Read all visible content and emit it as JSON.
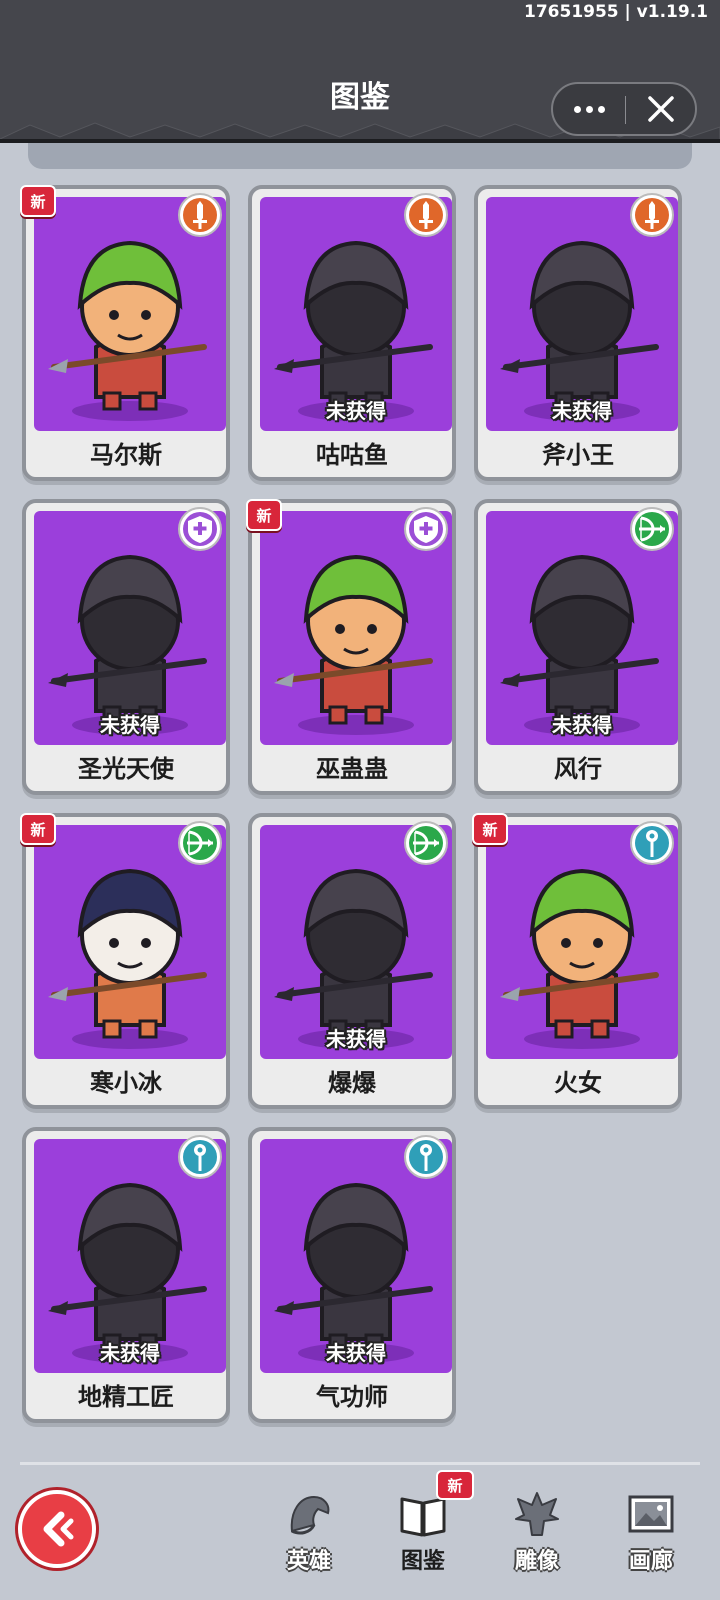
{
  "app": {
    "version": "17651955 | v1.19.1",
    "title": "图鉴"
  },
  "colors": {
    "card_bg": "#9b3fdb",
    "class_warrior": "#e0672a",
    "class_support": "#9b4fd6",
    "class_ranger": "#2aa84a",
    "class_mage": "#2f9fb8",
    "new_tag": "#d8263a"
  },
  "new_label": "新",
  "locked_label": "未获得",
  "heroes": [
    {
      "name": "马尔斯",
      "class_icon": "sword-icon",
      "class_color": "#e0672a",
      "owned": true,
      "new": true
    },
    {
      "name": "咕咕鱼",
      "class_icon": "sword-icon",
      "class_color": "#e0672a",
      "owned": false,
      "new": false
    },
    {
      "name": "斧小王",
      "class_icon": "sword-icon",
      "class_color": "#e0672a",
      "owned": false,
      "new": false
    },
    {
      "name": "圣光天使",
      "class_icon": "heal-shield-icon",
      "class_color": "#9b4fd6",
      "owned": false,
      "new": false
    },
    {
      "name": "巫蛊蛊",
      "class_icon": "heal-shield-icon",
      "class_color": "#9b4fd6",
      "owned": true,
      "new": true
    },
    {
      "name": "风行",
      "class_icon": "bow-icon",
      "class_color": "#2aa84a",
      "owned": false,
      "new": false
    },
    {
      "name": "寒小冰",
      "class_icon": "bow-icon",
      "class_color": "#2aa84a",
      "owned": true,
      "new": true
    },
    {
      "name": "爆爆",
      "class_icon": "bow-icon",
      "class_color": "#2aa84a",
      "owned": false,
      "new": false
    },
    {
      "name": "火女",
      "class_icon": "staff-icon",
      "class_color": "#2f9fb8",
      "owned": true,
      "new": true
    },
    {
      "name": "地精工匠",
      "class_icon": "staff-icon",
      "class_color": "#2f9fb8",
      "owned": false,
      "new": false
    },
    {
      "name": "气功师",
      "class_icon": "staff-icon",
      "class_color": "#2f9fb8",
      "owned": false,
      "new": false
    }
  ],
  "nav": {
    "back_icon": "back-arrow-icon",
    "items": [
      {
        "label": "英雄",
        "icon": "hero-helmet-icon",
        "active": false
      },
      {
        "label": "图鉴",
        "icon": "book-icon",
        "active": true,
        "new": true
      },
      {
        "label": "雕像",
        "icon": "statue-icon",
        "active": false
      },
      {
        "label": "画廊",
        "icon": "gallery-icon",
        "active": false
      }
    ]
  }
}
